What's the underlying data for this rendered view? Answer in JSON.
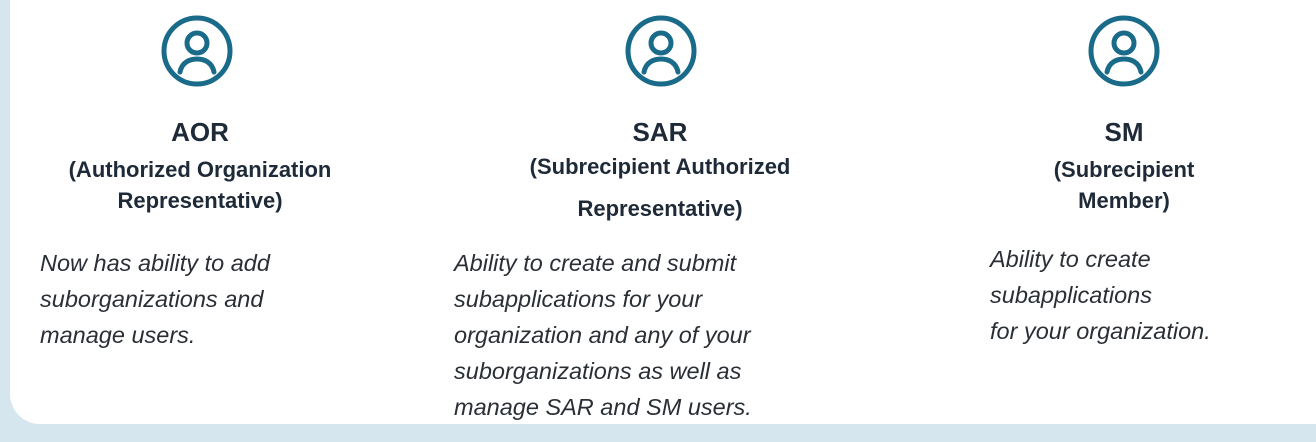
{
  "colors": {
    "icon_stroke": "#1a6b8a",
    "text": "#1e2a38",
    "background_edge": "#d6e6ee"
  },
  "roles": [
    {
      "icon": "user-circle-icon",
      "abbr": "AOR",
      "full_line1": "(Authorized Organization",
      "full_line2": "Representative)",
      "desc_line1": "Now has ability to add",
      "desc_line2": "suborganizations and",
      "desc_line3": "manage users."
    },
    {
      "icon": "user-circle-icon",
      "abbr": "SAR",
      "full_line1": "(Subrecipient Authorized",
      "full_line2": "Representative)",
      "desc_line1": "Ability to create and submit",
      "desc_line2": "subapplications for your",
      "desc_line3": "organization and any of your",
      "desc_line4": "suborganizations as well as",
      "desc_line5": "manage SAR and SM users."
    },
    {
      "icon": "user-circle-icon",
      "abbr": "SM",
      "full_line1": "(Subrecipient",
      "full_line2": "Member)",
      "desc_line1": "Ability to create",
      "desc_line2": "subapplications",
      "desc_line3": "for your organization."
    }
  ]
}
